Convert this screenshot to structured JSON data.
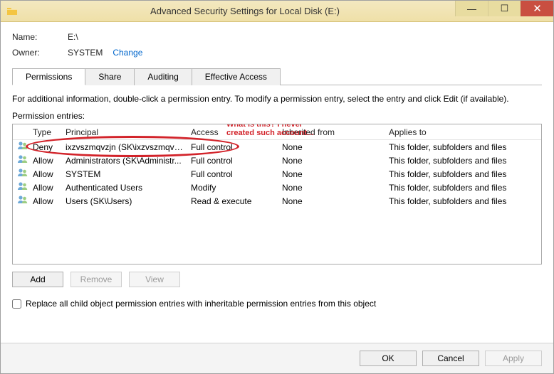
{
  "window": {
    "title": "Advanced Security Settings for Local Disk (E:)"
  },
  "info": {
    "name_label": "Name:",
    "name_value": "E:\\",
    "owner_label": "Owner:",
    "owner_value": "SYSTEM",
    "change_link": "Change"
  },
  "tabs": {
    "permissions": "Permissions",
    "share": "Share",
    "auditing": "Auditing",
    "effective": "Effective Access"
  },
  "description": "For additional information, double-click a permission entry. To modify a permission entry, select the entry and click Edit (if available).",
  "entries_label": "Permission entries:",
  "headers": {
    "type": "Type",
    "principal": "Principal",
    "access": "Access",
    "inherited": "Inherited from",
    "applies": "Applies to"
  },
  "rows": [
    {
      "type": "Deny",
      "principal": "ixzvszmqvzjn (SK\\ixzvszmqvzjn)",
      "access": "Full control",
      "inherited": "None",
      "applies": "This folder, subfolders and files"
    },
    {
      "type": "Allow",
      "principal": "Administrators (SK\\Administr...",
      "access": "Full control",
      "inherited": "None",
      "applies": "This folder, subfolders and files"
    },
    {
      "type": "Allow",
      "principal": "SYSTEM",
      "access": "Full control",
      "inherited": "None",
      "applies": "This folder, subfolders and files"
    },
    {
      "type": "Allow",
      "principal": "Authenticated Users",
      "access": "Modify",
      "inherited": "None",
      "applies": "This folder, subfolders and files"
    },
    {
      "type": "Allow",
      "principal": "Users (SK\\Users)",
      "access": "Read & execute",
      "inherited": "None",
      "applies": "This folder, subfolders and files"
    }
  ],
  "buttons": {
    "add": "Add",
    "remove": "Remove",
    "view": "View"
  },
  "checkbox_label": "Replace all child object permission entries with inheritable permission entries from this object",
  "footer": {
    "ok": "OK",
    "cancel": "Cancel",
    "apply": "Apply"
  },
  "annotation": {
    "line1": "What is this? I never",
    "line2": "created such account..."
  }
}
